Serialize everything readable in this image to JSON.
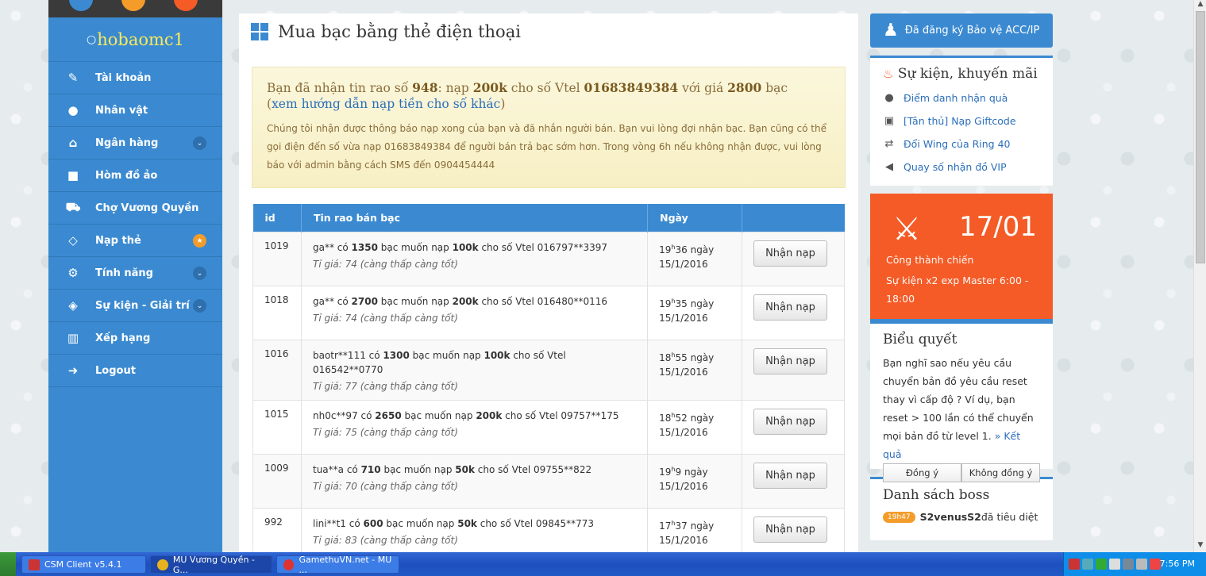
{
  "sidebar": {
    "username": "hobaomc1",
    "items": [
      {
        "label": "Tài khoản"
      },
      {
        "label": "Nhân vật"
      },
      {
        "label": "Ngân hàng"
      },
      {
        "label": "Hòm đồ ảo"
      },
      {
        "label": "Chợ Vương Quyền"
      },
      {
        "label": "Nạp thẻ"
      },
      {
        "label": "Tính năng"
      },
      {
        "label": "Sự kiện - Giải trí"
      },
      {
        "label": "Xếp hạng"
      },
      {
        "label": "Logout"
      }
    ]
  },
  "main": {
    "title": "Mua bạc bằng thẻ điện thoại",
    "notice": {
      "p1": "Bạn đã nhận tin rao số ",
      "id": "948",
      "p2": ": nạp ",
      "amount": "200k",
      "p3": " cho số Vtel ",
      "phone": "01683849384",
      "p4": " với giá ",
      "price": "2800",
      "p5": " bạc",
      "link_open": "(",
      "link": "xem hướng dẫn nạp tiền cho số khác",
      "link_close": ")",
      "body": "Chúng tôi nhận được thông báo nạp xong của bạn và đã nhắn người bán. Bạn vui lòng đợi nhận bạc. Bạn cũng có thể gọi điện đến số vừa nạp 01683849384 để người bán trả bạc sớm hơn. Trong vòng 6h nếu không nhận được, vui lòng báo với admin bằng cách SMS đến 0904454444"
    },
    "table": {
      "headers": [
        "id",
        "Tin rao bán bạc",
        "Ngày",
        ""
      ],
      "button_label": "Nhận nạp",
      "rows": [
        {
          "id": "1019",
          "seller": "ga** có ",
          "silver": "1350",
          "mid": " bạc muốn nạp ",
          "amount": "100k",
          "phone": " cho số Vtel 016797**3397",
          "rate": "Tỉ giá: 74 (càng thấp càng tốt)",
          "hour": "19",
          "h": "h",
          "min": "36 ngày",
          "date": "15/1/2016"
        },
        {
          "id": "1018",
          "seller": "ga** có ",
          "silver": "2700",
          "mid": " bạc muốn nạp ",
          "amount": "200k",
          "phone": " cho số Vtel 016480**0116",
          "rate": "Tỉ giá: 74 (càng thấp càng tốt)",
          "hour": "19",
          "h": "h",
          "min": "35 ngày",
          "date": "15/1/2016"
        },
        {
          "id": "1016",
          "seller": "baotr**111 có ",
          "silver": "1300",
          "mid": " bạc muốn nạp ",
          "amount": "100k",
          "phone": " cho số Vtel 016542**0770",
          "rate": "Tỉ giá: 77 (càng thấp càng tốt)",
          "hour": "18",
          "h": "h",
          "min": "55 ngày",
          "date": "15/1/2016"
        },
        {
          "id": "1015",
          "seller": "nh0c**97 có ",
          "silver": "2650",
          "mid": " bạc muốn nạp ",
          "amount": "200k",
          "phone": " cho số Vtel 09757**175",
          "rate": "Tỉ giá: 75 (càng thấp càng tốt)",
          "hour": "18",
          "h": "h",
          "min": "52 ngày",
          "date": "15/1/2016"
        },
        {
          "id": "1009",
          "seller": "tua**a có ",
          "silver": "710",
          "mid": " bạc muốn nạp ",
          "amount": "50k",
          "phone": " cho số Vtel 09755**822",
          "rate": "Tỉ giá: 70 (càng thấp càng tốt)",
          "hour": "19",
          "h": "h",
          "min": "9 ngày",
          "date": "15/1/2016"
        },
        {
          "id": "992",
          "seller": "lini**t1 có ",
          "silver": "600",
          "mid": " bạc muốn nạp ",
          "amount": "50k",
          "phone": " cho số Vtel 09845**773",
          "rate": "Tỉ giá: 83 (càng thấp càng tốt)",
          "hour": "17",
          "h": "h",
          "min": "37 ngày",
          "date": "15/1/2016"
        }
      ]
    }
  },
  "right": {
    "protect": "Đã đăng ký Bảo vệ ACC/IP",
    "events_title": "Sự kiện, khuyến mãi",
    "events": [
      {
        "label": "Điểm danh nhận quà"
      },
      {
        "label": "[Tân thủ] Nạp Giftcode"
      },
      {
        "label": "Đổi Wing của Ring 40"
      },
      {
        "label": "Quay số nhận đồ VIP"
      }
    ],
    "event_card": {
      "date": "17/01",
      "title": "Công thành chiến",
      "desc": "Sự kiện x2 exp Master 6:00 - 18:00"
    },
    "poll": {
      "title": "Biểu quyết",
      "question": "Bạn nghĩ sao nếu yêu cầu chuyển bản đồ yêu cầu reset thay vì cấp độ ? Ví dụ, bạn reset > 100 lần có thể chuyển mọi bản đồ từ level 1. ",
      "result_link": "» Kết quả",
      "agree": "Đồng ý",
      "disagree": "Không đồng ý"
    },
    "boss": {
      "title": "Danh sách boss",
      "badge": "19h47",
      "name": "S2venusS2",
      "suffix": " đã tiêu diệt"
    }
  },
  "taskbar": {
    "items": [
      {
        "label": "CSM Client v5.4.1"
      },
      {
        "label": "MU Vương Quyền - G..."
      },
      {
        "label": "GamethuVN.net - MU ..."
      }
    ],
    "clock": "7:56 PM"
  },
  "colors": {
    "primary": "#3b8ad1",
    "event_orange": "#f45b26",
    "notice_bg": "#fbf7dc",
    "username_yellow": "#f8ea5a"
  }
}
